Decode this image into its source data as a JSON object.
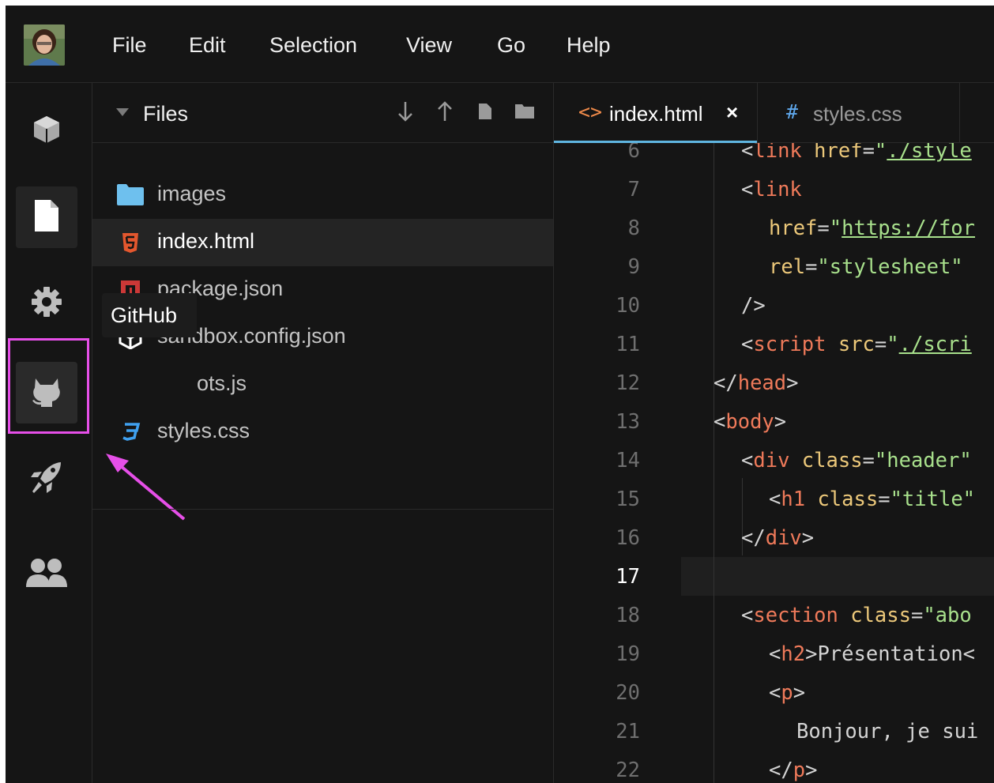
{
  "menu": {
    "items": [
      "File",
      "Edit",
      "Selection",
      "View",
      "Go",
      "Help"
    ]
  },
  "activity_bar": {
    "items": [
      "sandbox-info-icon",
      "file-icon",
      "gear-icon",
      "github-icon",
      "rocket-icon",
      "users-icon"
    ],
    "tooltip": "GitHub"
  },
  "explorer": {
    "title": "Files",
    "files": [
      {
        "name": "images",
        "icon": "folder-icon"
      },
      {
        "name": "index.html",
        "icon": "html5-icon"
      },
      {
        "name": "package.json",
        "icon": "npm-icon"
      },
      {
        "name": "sandbox.config.json",
        "icon": "codesandbox-icon"
      },
      {
        "name": "ots.js",
        "icon": "js-icon"
      },
      {
        "name": "styles.css",
        "icon": "css3-icon"
      }
    ]
  },
  "editor": {
    "tabs": [
      {
        "label": "index.html",
        "icon": "<>",
        "close": "×"
      },
      {
        "label": "styles.css",
        "icon": "#"
      }
    ],
    "line_numbers": [
      "6",
      "7",
      "8",
      "9",
      "10",
      "11",
      "12",
      "13",
      "14",
      "15",
      "16",
      "17",
      "18",
      "19",
      "20",
      "21",
      "22"
    ],
    "current_line": "17"
  },
  "annotation": {
    "highlight_color": "#e64fe8"
  }
}
